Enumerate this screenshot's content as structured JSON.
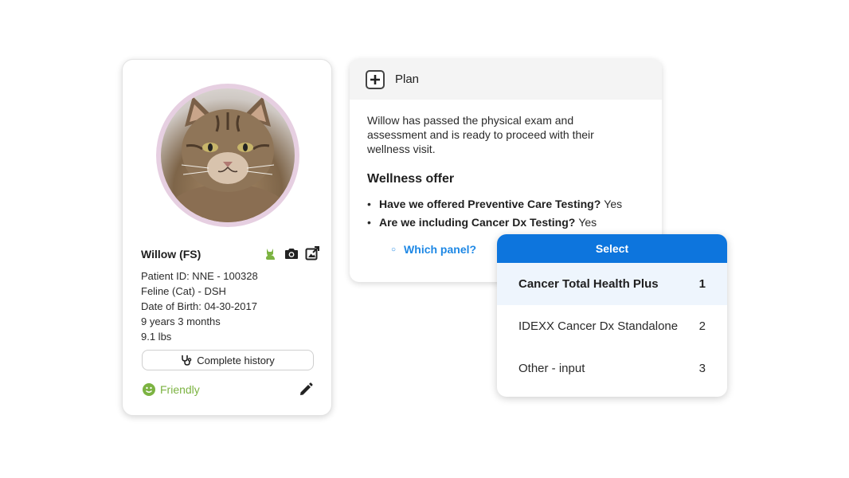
{
  "patient": {
    "name": "Willow (FS)",
    "details": [
      "Patient ID: NNE - 100328",
      "Feline (Cat) - DSH",
      "Date of Birth: 04-30-2017",
      "9 years 3 months",
      "9.1 lbs"
    ],
    "icons": [
      "cat-icon",
      "camera-icon",
      "image-upload-icon"
    ],
    "history_button": "Complete history",
    "temperament": "Friendly",
    "temperament_color": "#7cb342"
  },
  "plan": {
    "title": "Plan",
    "summary": "Willow has passed the physical exam and assessment and is ready to proceed with their wellness visit.",
    "wellness_title": "Wellness offer",
    "offers": [
      {
        "question": "Have we offered Preventive Care Testing?",
        "answer": "Yes"
      },
      {
        "question": "Are we including Cancer Dx Testing?",
        "answer": "Yes"
      }
    ],
    "panel_link": "Which panel?"
  },
  "select": {
    "header": "Select",
    "accent": "#0d75dd",
    "options": [
      {
        "label": "Cancer Total Health Plus",
        "num": "1",
        "selected": true
      },
      {
        "label": "IDEXX Cancer Dx Standalone",
        "num": "2",
        "selected": false
      },
      {
        "label": "Other - input",
        "num": "3",
        "selected": false
      }
    ]
  }
}
